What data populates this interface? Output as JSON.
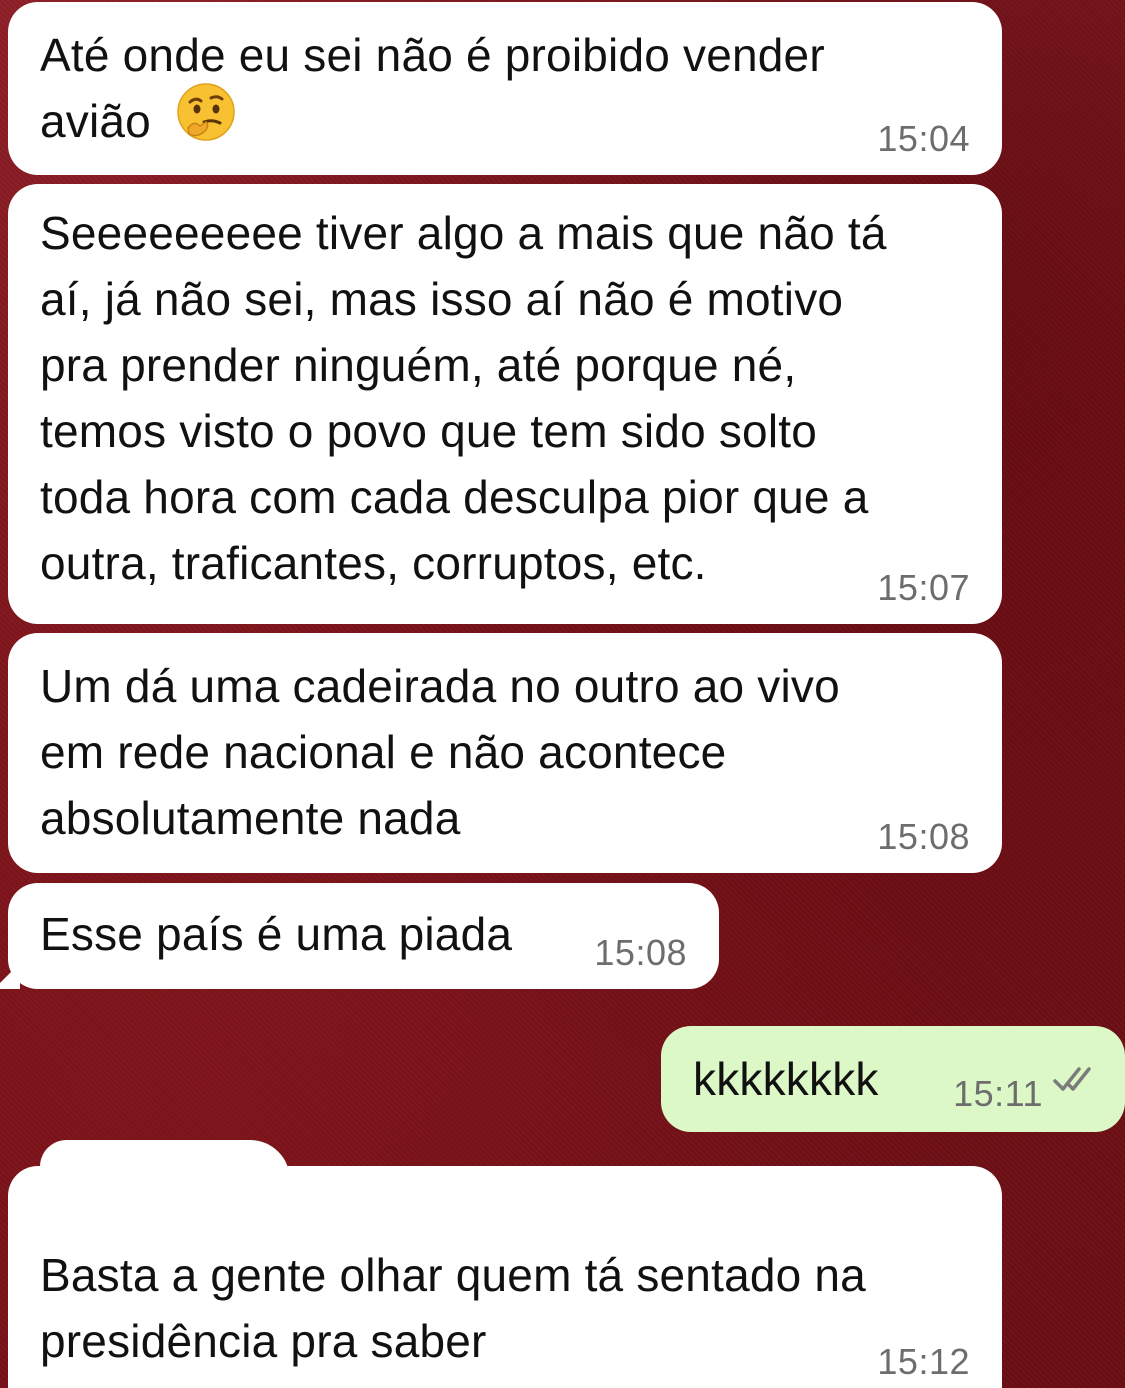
{
  "messages": [
    {
      "text": "Até onde eu sei não é proibido vender\navião",
      "emoji": "thinking-face-emoji",
      "time": "15:04"
    },
    {
      "text": "Seeeeeeeee tiver algo a mais que não tá\naí, já não sei, mas isso aí não é motivo\npra prender ninguém, até porque né,\ntemos visto o povo que tem sido solto\ntoda hora com cada desculpa pior que a\noutra, traficantes, corruptos, etc.",
      "time": "15:07"
    },
    {
      "text": "Um dá uma cadeirada no outro ao vivo\nem rede nacional e não acontece\nabsolutamente nada",
      "time": "15:08"
    },
    {
      "text": "Esse país é uma piada",
      "time": "15:08"
    },
    {
      "text": "kkkkkkkk",
      "time": "15:11",
      "status_icon": "double-check-icon"
    },
    {
      "text": "Basta a gente olhar quem tá sentado na\npresidência pra saber",
      "time": "15:12"
    }
  ],
  "colors": {
    "incoming_bubble": "#ffffff",
    "outgoing_bubble": "#dcf8c6",
    "background": "#7a1219",
    "timestamp": "#6d6d6d"
  }
}
